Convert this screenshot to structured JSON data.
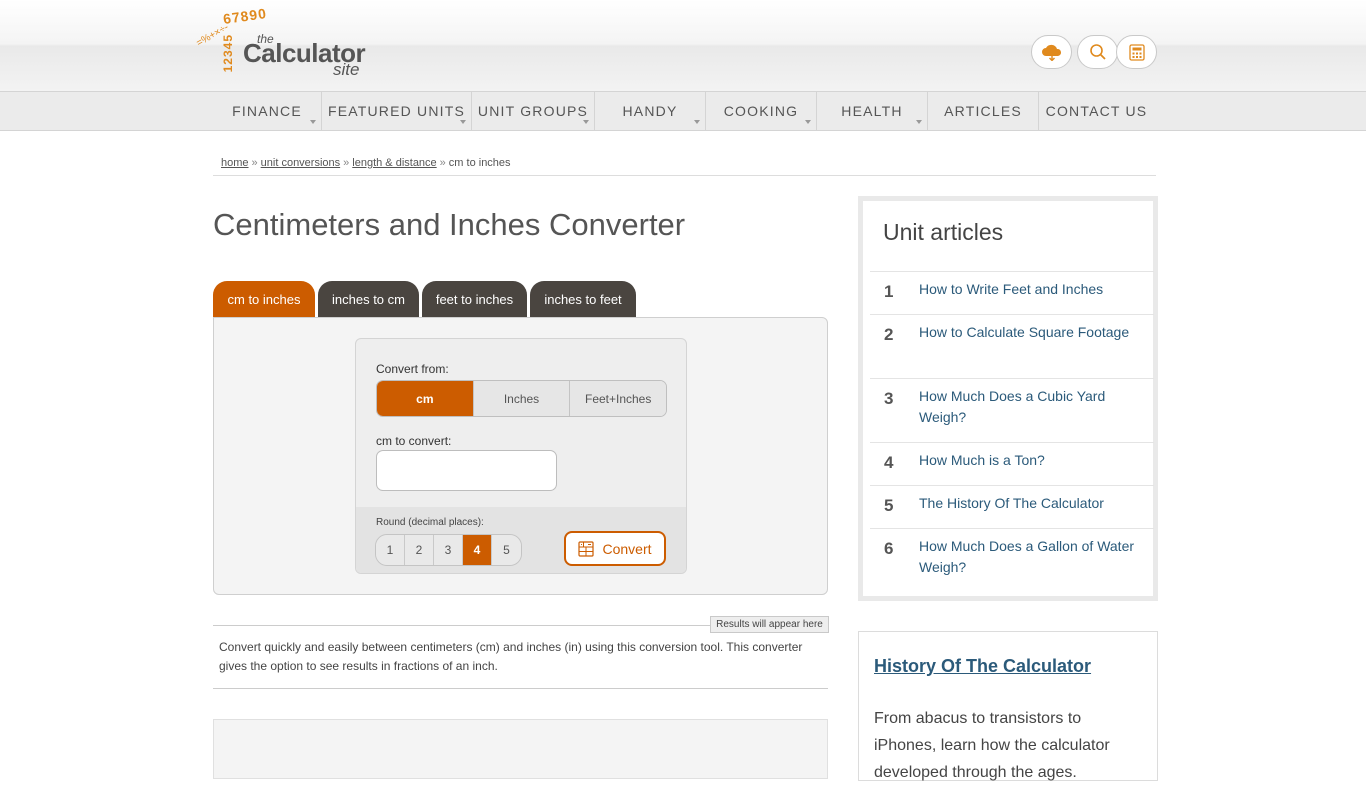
{
  "logo": {
    "numbers": "67890",
    "numbers_vertical": "12345",
    "operators": "=%+×÷-",
    "the": "the",
    "calculator": "Calculator",
    "site": "site"
  },
  "header": {
    "icons": [
      "cloud-icon",
      "search-icon",
      "calculator-icon"
    ]
  },
  "nav": {
    "items": [
      {
        "label": "FINANCE"
      },
      {
        "label": "FEATURED UNITS"
      },
      {
        "label": "UNIT GROUPS"
      },
      {
        "label": "HANDY"
      },
      {
        "label": "COOKING"
      },
      {
        "label": "HEALTH"
      },
      {
        "label": "ARTICLES"
      },
      {
        "label": "CONTACT US"
      }
    ]
  },
  "breadcrumb": {
    "home": "home",
    "unit_conversions": "unit conversions",
    "length": "length & distance",
    "current": "cm to inches",
    "separator": "»"
  },
  "page": {
    "title": "Centimeters and Inches Converter"
  },
  "tabs": [
    {
      "label": "cm to inches"
    },
    {
      "label": "inches to cm"
    },
    {
      "label": "feet to inches"
    },
    {
      "label": "inches to feet"
    }
  ],
  "converter": {
    "convert_from_label": "Convert from:",
    "units": [
      "cm",
      "Inches",
      "Feet+Inches"
    ],
    "selected_unit": "cm",
    "input_label": "cm to convert:",
    "input_value": "",
    "round_label": "Round (decimal places):",
    "round_options": [
      "1",
      "2",
      "3",
      "4",
      "5"
    ],
    "round_selected": "4",
    "convert_label": "Convert",
    "accent_color": "#cc5c00"
  },
  "results": {
    "badge": "Results will appear here",
    "description": "Convert quickly and easily between centimeters (cm) and inches (in) using this conversion tool. This converter gives the option to see results in fractions of an inch."
  },
  "sidebar": {
    "title": "Unit articles",
    "articles": [
      {
        "num": "1",
        "text": "How to Write Feet and Inches"
      },
      {
        "num": "2",
        "text": "How to Calculate Square Footage"
      },
      {
        "num": "3",
        "text": "How Much Does a Cubic Yard Weigh?"
      },
      {
        "num": "4",
        "text": "How Much is a Ton?"
      },
      {
        "num": "5",
        "text": "The History Of The Calculator"
      },
      {
        "num": "6",
        "text": "How Much Does a Gallon of Water Weigh?"
      }
    ]
  },
  "history": {
    "title": "History Of The Calculator",
    "text": "From abacus to transistors to iPhones, learn how the calculator developed through the ages."
  }
}
